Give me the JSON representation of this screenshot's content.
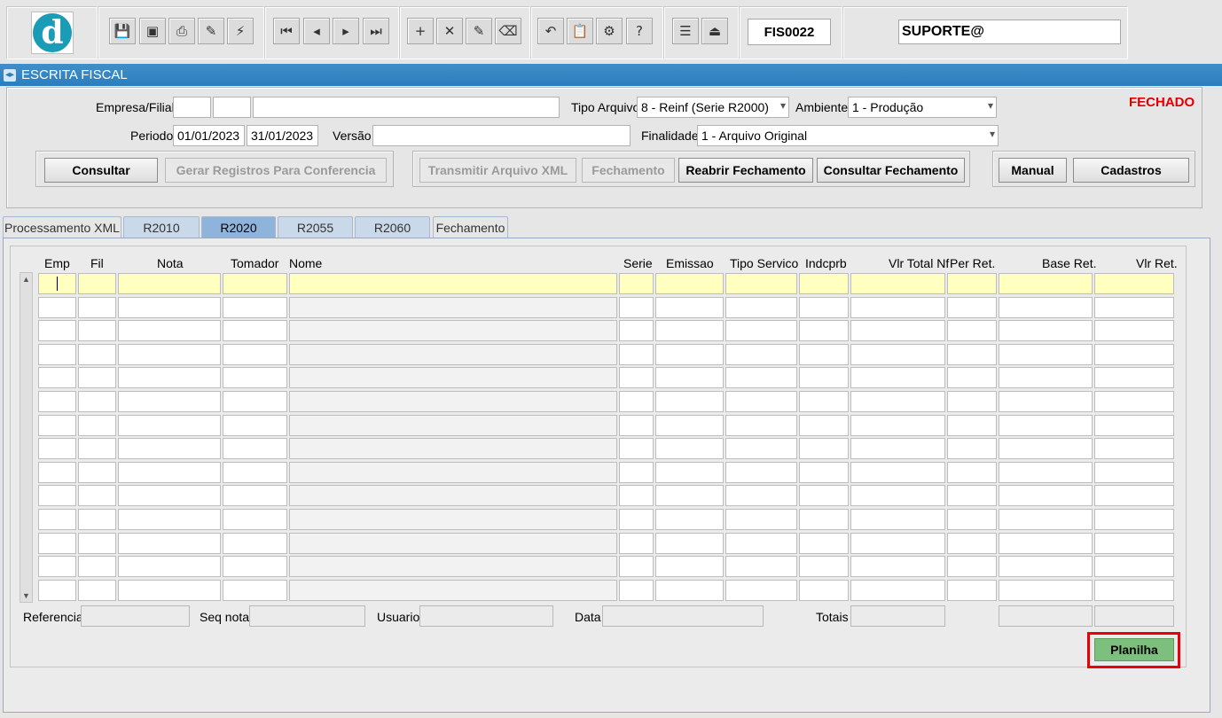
{
  "toolbar": {
    "form_code": "FIS0022",
    "user": "SUPORTE@",
    "logo_letter": "d",
    "buttons": [
      {
        "name": "save-icon",
        "glyph": "💾"
      },
      {
        "name": "window-icon",
        "glyph": "▣"
      },
      {
        "name": "print-icon",
        "glyph": "⎙"
      },
      {
        "name": "query-help-icon",
        "glyph": "✎"
      },
      {
        "name": "execute-query-icon",
        "glyph": "⚡"
      },
      {
        "name": "first-record-icon",
        "glyph": "⏮"
      },
      {
        "name": "previous-record-icon",
        "glyph": "◂"
      },
      {
        "name": "next-record-icon",
        "glyph": "▸"
      },
      {
        "name": "last-record-icon",
        "glyph": "⏭"
      },
      {
        "name": "insert-record-icon",
        "glyph": "+"
      },
      {
        "name": "delete-record-icon",
        "glyph": "✕"
      },
      {
        "name": "edit-record-icon",
        "glyph": "✎"
      },
      {
        "name": "clear-icon",
        "glyph": "⌫"
      },
      {
        "name": "undo-icon",
        "glyph": "↶"
      },
      {
        "name": "clipboard-icon",
        "glyph": "📋"
      },
      {
        "name": "tools-icon",
        "glyph": "⚙"
      },
      {
        "name": "help-icon",
        "glyph": "?"
      },
      {
        "name": "menu-icon",
        "glyph": "☰"
      },
      {
        "name": "exit-icon",
        "glyph": "⏏"
      }
    ]
  },
  "title": "ESCRITA FISCAL",
  "status": "FECHADO",
  "form": {
    "empresa_label": "Empresa/Filial",
    "empresa_value": "",
    "filial_value": "",
    "empresa_desc": "",
    "tipo_arquivo_label": "Tipo Arquivo",
    "tipo_arquivo_value": "8 - Reinf (Serie R2000)",
    "ambiente_label": "Ambiente",
    "ambiente_value": "1 - Produção",
    "periodo_label": "Periodo",
    "periodo_inicio": "01/01/2023",
    "periodo_fim": "31/01/2023",
    "versao_label": "Versão",
    "versao_value": "",
    "finalidade_label": "Finalidade",
    "finalidade_value": "1 - Arquivo Original"
  },
  "buttons": {
    "consultar": "Consultar",
    "gerar_registros": "Gerar Registros Para Conferencia",
    "transmitir": "Transmitir Arquivo XML",
    "fechamento": "Fechamento",
    "reabrir": "Reabrir Fechamento",
    "consultar_fechamento": "Consultar Fechamento",
    "manual": "Manual",
    "cadastros": "Cadastros",
    "planilha": "Planilha"
  },
  "tabs": [
    {
      "label": "Processamento XML"
    },
    {
      "label": "R2010"
    },
    {
      "label": "R2020"
    },
    {
      "label": "R2055"
    },
    {
      "label": "R2060"
    },
    {
      "label": "Fechamento"
    }
  ],
  "grid": {
    "columns": [
      "Emp",
      "Fil",
      "Nota",
      "Tomador",
      "Nome",
      "Serie",
      "Emissao",
      "Tipo Servico",
      "Indcprb",
      "Vlr Total Nf",
      "Per Ret.",
      "Base Ret.",
      "Vlr Ret."
    ],
    "row_count": 14
  },
  "footer": {
    "referencia_label": "Referencia",
    "seq_nota_label": "Seq nota",
    "usuario_label": "Usuario",
    "data_label": "Data",
    "totais_label": "Totais"
  }
}
